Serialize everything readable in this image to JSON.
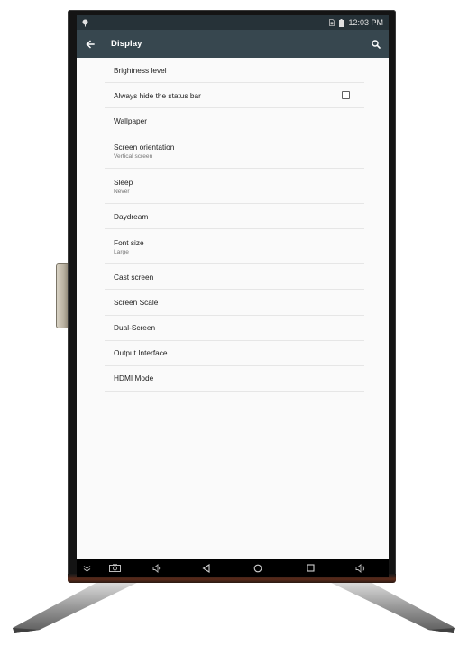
{
  "status_bar": {
    "time": "12:03 PM",
    "icons": [
      "notification-icon",
      "sim-card-icon",
      "battery-icon"
    ]
  },
  "app_bar": {
    "title": "Display",
    "back_icon": "arrow-left-icon",
    "search_icon": "search-icon"
  },
  "settings": [
    {
      "label": "Brightness level",
      "summary": null
    },
    {
      "label": "Always hide the status bar",
      "summary": null,
      "checkbox": false
    },
    {
      "label": "Wallpaper",
      "summary": null
    },
    {
      "label": "Screen orientation",
      "summary": "Vertical screen"
    },
    {
      "label": "Sleep",
      "summary": "Never"
    },
    {
      "label": "Daydream",
      "summary": null
    },
    {
      "label": "Font size",
      "summary": "Large"
    },
    {
      "label": "Cast screen",
      "summary": null
    },
    {
      "label": "Screen Scale",
      "summary": null
    },
    {
      "label": "Dual-Screen",
      "summary": null
    },
    {
      "label": "Output Interface",
      "summary": null
    },
    {
      "label": "HDMI Mode",
      "summary": null
    }
  ],
  "nav_bar": {
    "icons": [
      "hide-bar-icon",
      "screenshot-icon",
      "volume-down-icon",
      "back-icon",
      "home-icon",
      "recents-icon",
      "volume-up-icon"
    ]
  },
  "colors": {
    "status_bar": "#263238",
    "app_bar": "#37474f",
    "background": "#fafafa",
    "divider": "#e6e6e6"
  }
}
